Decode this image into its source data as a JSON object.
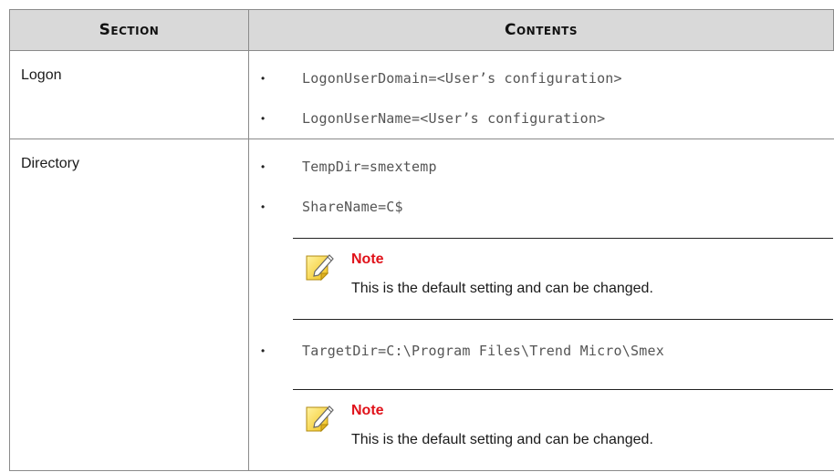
{
  "table": {
    "headers": {
      "section": "Section",
      "contents": "Contents"
    },
    "rows": [
      {
        "section": "Logon",
        "items": [
          "LogonUserDomain=<User’s configuration>",
          "LogonUserName=<User’s configuration>"
        ]
      },
      {
        "section": "Directory",
        "items": [
          "TempDir=smextemp",
          "ShareName=C$",
          "TargetDir=C:\\Program Files\\Trend Micro\\Smex"
        ],
        "notes": [
          {
            "title": "Note",
            "text": "This is the default setting and can be changed."
          },
          {
            "title": "Note",
            "text": "This is the default setting and can be changed."
          }
        ]
      }
    ]
  },
  "colors": {
    "header_bg": "#d9d9d9",
    "note_title": "#e0121a",
    "code_text": "#555555"
  },
  "icons": {
    "note": "note-pencil-icon",
    "bullet": "bullet-dot"
  }
}
